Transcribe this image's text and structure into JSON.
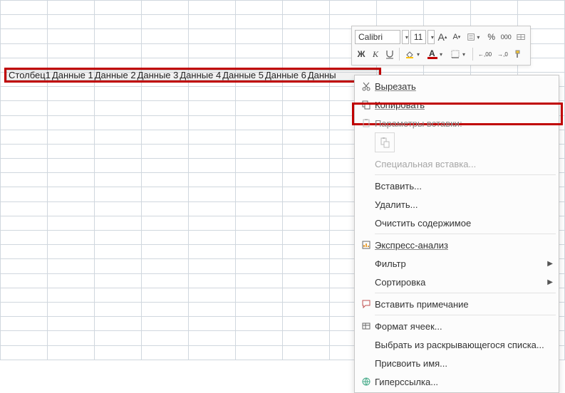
{
  "row_data": [
    "Столбец1",
    "Данные 1",
    "Данные 2",
    "Данные 3",
    "Данные 4",
    "Данные 5",
    "Данные 6",
    "Данны"
  ],
  "minibar": {
    "font_name": "Calibri",
    "font_size": "11",
    "grow": "A",
    "shrink": "A",
    "percent": "%",
    "thousand": "000",
    "bold": "Ж",
    "italic": "К",
    "fontcolor_letter": "А",
    "increase_dec": ",00",
    "decrease_dec": ",0"
  },
  "ctx": {
    "cut": "Вырезать",
    "copy": "Копировать",
    "paste_opts": "Параметры вставки:",
    "paste_special": "Специальная вставка...",
    "insert": "Вставить...",
    "delete": "Удалить...",
    "clear": "Очистить содержимое",
    "quick": "Экспресс-анализ",
    "filter": "Фильтр",
    "sort": "Сортировка",
    "comment": "Вставить примечание",
    "format_cells": "Формат ячеек...",
    "dropdown": "Выбрать из раскрывающегося списка...",
    "name": "Присвоить имя...",
    "hyperlink": "Гиперссылка..."
  }
}
